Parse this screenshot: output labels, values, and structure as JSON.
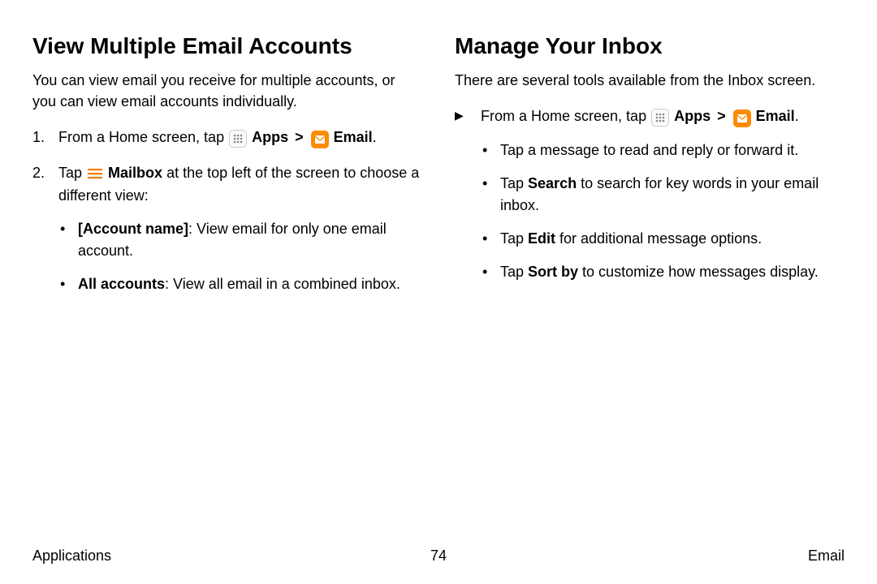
{
  "left": {
    "heading": "View Multiple Email Accounts",
    "lead": "You can view email you receive for multiple accounts, or you can view email accounts individually.",
    "step1_pre": "From a Home screen, tap ",
    "apps_label": "Apps",
    "chevron": ">",
    "email_label": "Email",
    "period": ".",
    "step2_pre": "Tap ",
    "mailbox_label": "Mailbox",
    "step2_post": " at the top left of the screen to choose a different view:",
    "sub1_bold": "[Account name]",
    "sub1_rest": ": View email for only one email account.",
    "sub2_bold": "All accounts",
    "sub2_rest": ": View all email in a combined inbox."
  },
  "right": {
    "heading": "Manage Your Inbox",
    "lead": "There are several tools available from the Inbox screen.",
    "arrow_pre": "From a Home screen, tap ",
    "apps_label": "Apps",
    "chevron": ">",
    "email_label": "Email",
    "period": ".",
    "b1": "Tap a message to read and reply or forward it.",
    "b2_pre": "Tap ",
    "b2_bold": "Search",
    "b2_post": " to search for key words in your email inbox.",
    "b3_pre": "Tap ",
    "b3_bold": "Edit",
    "b3_post": " for additional message options.",
    "b4_pre": "Tap ",
    "b4_bold": "Sort by",
    "b4_post": " to customize how messages display."
  },
  "footer": {
    "left": "Applications",
    "center": "74",
    "right": "Email"
  }
}
